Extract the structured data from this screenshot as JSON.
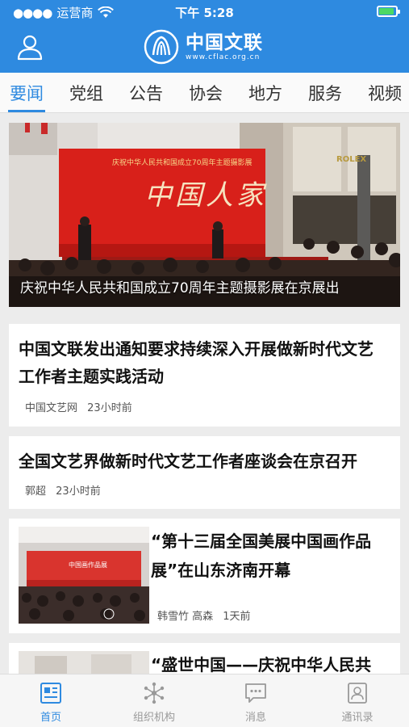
{
  "status_bar": {
    "carrier": "运营商",
    "time": "下午 5:28"
  },
  "app_bar": {
    "title": "中国文联",
    "url": "www.cflac.org.cn",
    "brand_color": "#2e8ae0"
  },
  "tabs": [
    {
      "label": "要闻",
      "active": true
    },
    {
      "label": "党组",
      "active": false
    },
    {
      "label": "公告",
      "active": false
    },
    {
      "label": "协会",
      "active": false
    },
    {
      "label": "地方",
      "active": false
    },
    {
      "label": "服务",
      "active": false
    },
    {
      "label": "视频",
      "active": false
    }
  ],
  "hero": {
    "caption": "庆祝中华人民共和国成立70周年主题摄影展在京展出",
    "stage_title": "庆祝中华人民共和国成立70周年主题摄影展",
    "stage_calligraphy": "中国人家",
    "store_sign": "ROLEX"
  },
  "news": [
    {
      "headline": "中国文联发出通知要求持续深入开展做新时代文艺工作者主题实践活动",
      "source": "中国文艺网",
      "time": "23小时前"
    },
    {
      "headline": "全国文艺界做新时代文艺工作者座谈会在京召开",
      "source": "郭超",
      "time": "23小时前"
    },
    {
      "headline": "“第十三届全国美展中国画作品展”在山东济南开幕",
      "source": "韩雪竹 高森",
      "time": "1天前",
      "thumb_banner": "中国画作品展"
    },
    {
      "headline": "“盛世中国——庆祝中华人民共"
    }
  ],
  "bottom_nav": [
    {
      "label": "首页",
      "icon": "home-news-icon",
      "active": true
    },
    {
      "label": "组织机构",
      "icon": "network-icon",
      "active": false
    },
    {
      "label": "消息",
      "icon": "message-icon",
      "active": false
    },
    {
      "label": "通讯录",
      "icon": "contacts-icon",
      "active": false
    }
  ]
}
